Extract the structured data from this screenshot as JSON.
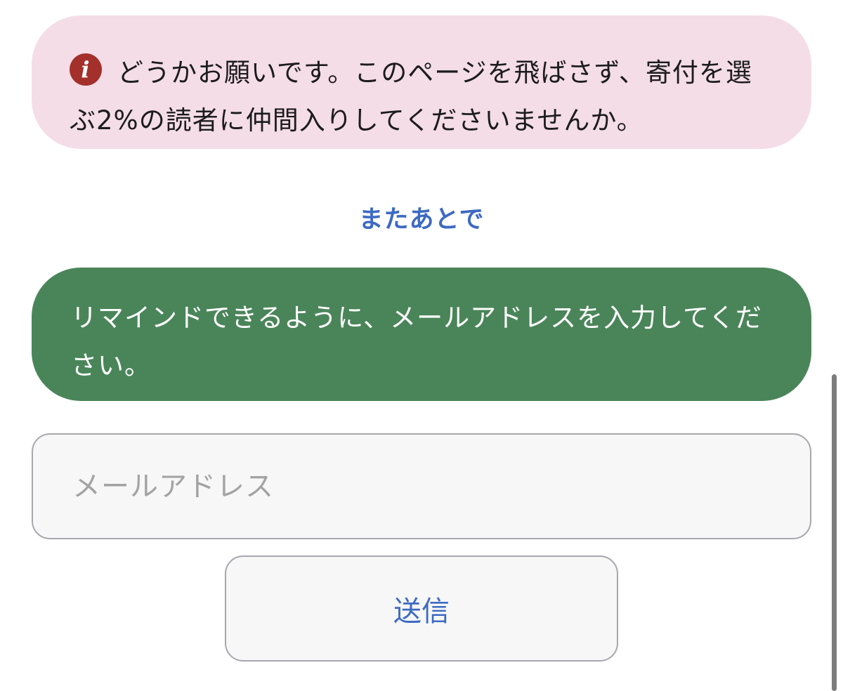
{
  "notice": {
    "icon": "info-icon",
    "icon_glyph": "i",
    "text": "どうかお願いです。このページを飛ばさず、寄付を選ぶ2%の読者に仲間入りしてくださいませんか。",
    "background_color": "#f4dde7",
    "icon_color": "#a3302b"
  },
  "later_link": {
    "label": "またあとで",
    "color": "#3d6ac1"
  },
  "reminder": {
    "text": "リマインドできるように、メールアドレスを入力してください。",
    "background_color": "#4a8559"
  },
  "email_field": {
    "placeholder": "メールアドレス",
    "value": ""
  },
  "submit_button": {
    "label": "送信",
    "color": "#3d6ac1"
  }
}
